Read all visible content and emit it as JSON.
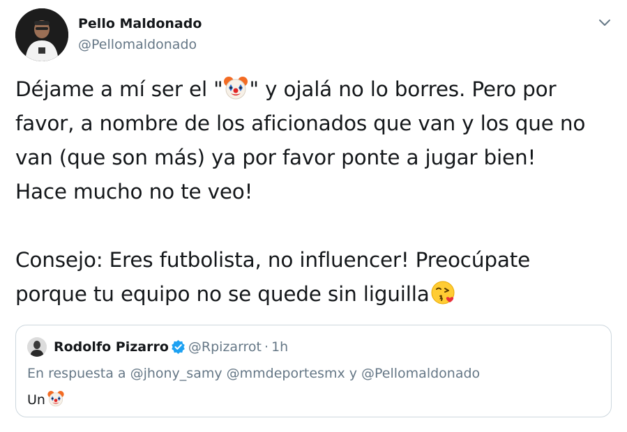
{
  "author": {
    "name": "Pello Maldonado",
    "handle": "@Pellomaldonado"
  },
  "tweet": {
    "lines_part1": [
      [
        "Déjame a mí ser el \"",
        "clown-face-emoji",
        "\" y ojalá no lo borres. Pero por"
      ],
      "favor, a nombre de los aficionados que van y los que no",
      "van (que son más) ya por favor ponte a jugar bien!",
      "Hace mucho no te veo!"
    ],
    "line1_before": "Déjame a mí ser el \"",
    "line1_after": "\" y ojalá no lo borres. Pero por",
    "line2": "favor, a nombre de los aficionados que van y los que no",
    "line3": "van (que son más) ya por favor ponte a jugar bien!",
    "line4": "Hace mucho no te veo!",
    "line5": "Consejo: Eres futbolista, no influencer! Preocúpate",
    "line6": "porque tu equipo no se quede sin liguilla",
    "emojis": [
      "clown-face-emoji",
      "face-blowing-kiss-emoji"
    ]
  },
  "quoted_tweet": {
    "name": "Rodolfo Pizarro",
    "verified": true,
    "handle": "@Rpizarrot",
    "separator": "·",
    "time": "1h",
    "reply_prefix": "En respuesta a @jhony_samy @mmdeportesmx y @Pellomaldonado",
    "text": "Un",
    "emoji": "clown-face-emoji"
  },
  "colors": {
    "primary_text": "#14171a",
    "secondary_text": "#657786",
    "border": "#ccd6dd",
    "verified_blue": "#1da1f2"
  },
  "icons": {
    "menu_caret": "chevron-down-icon",
    "verified": "verified-badge-icon"
  }
}
